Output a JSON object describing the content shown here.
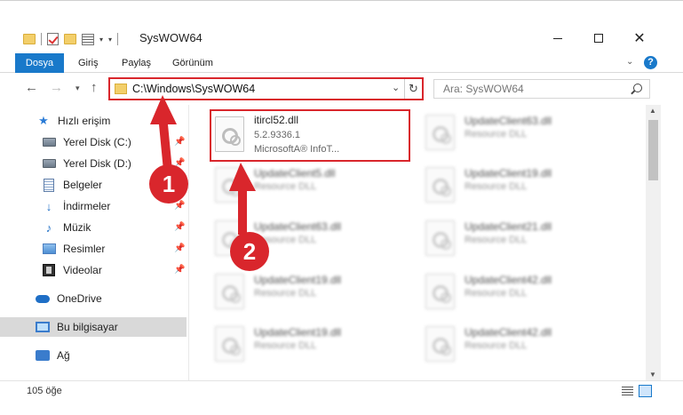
{
  "window": {
    "title": "SysWOW64",
    "qat_dropdown": "▾",
    "min": "",
    "max": "",
    "close": "✕"
  },
  "ribbon": {
    "tabs": [
      "Dosya",
      "Giriş",
      "Paylaş",
      "Görünüm"
    ],
    "help": "?",
    "collapse": "⌄"
  },
  "nav": {
    "back": "←",
    "forward": "→",
    "recent": "▾",
    "up": "↑",
    "address": "C:\\Windows\\SysWOW64",
    "address_drop": "⌄",
    "refresh": "↻",
    "search_placeholder": "Ara: SysWOW64"
  },
  "sidebar": {
    "items": [
      {
        "label": "Hızlı erişim",
        "icon": "star-icon",
        "pinned": false
      },
      {
        "label": "Yerel Disk (C:)",
        "icon": "disk-icon",
        "pinned": true
      },
      {
        "label": "Yerel Disk (D:)",
        "icon": "disk-icon",
        "pinned": true
      },
      {
        "label": "Belgeler",
        "icon": "document-icon",
        "pinned": true
      },
      {
        "label": "İndirmeler",
        "icon": "download-icon",
        "pinned": true
      },
      {
        "label": "Müzik",
        "icon": "music-icon",
        "pinned": true
      },
      {
        "label": "Resimler",
        "icon": "pictures-icon",
        "pinned": true
      },
      {
        "label": "Videolar",
        "icon": "video-icon",
        "pinned": true
      },
      {
        "label": "OneDrive",
        "icon": "cloud-icon",
        "pinned": false
      },
      {
        "label": "Bu bilgisayar",
        "icon": "computer-icon",
        "pinned": false
      },
      {
        "label": "Ağ",
        "icon": "network-icon",
        "pinned": false
      }
    ],
    "pin_glyph": "📌"
  },
  "files": {
    "highlighted": {
      "name": "itircl52.dll",
      "version": "5.2.9336.1",
      "company": "MicrosoftA® InfoT..."
    },
    "left_column": [
      {
        "name": "UpdateClient5.dll",
        "type": "Resource DLL"
      },
      {
        "name": "UpdateClient63.dll",
        "type": "Resource DLL"
      },
      {
        "name": "UpdateClient19.dll",
        "type": "Resource DLL"
      },
      {
        "name": "UpdateClient19.dll",
        "type": "Resource DLL"
      }
    ],
    "right_column": [
      {
        "name": "UpdateClient63.dll",
        "type": "Resource DLL"
      },
      {
        "name": "UpdateClient19.dll",
        "type": "Resource DLL"
      },
      {
        "name": "UpdateClient21.dll",
        "type": "Resource DLL"
      },
      {
        "name": "UpdateClient42.dll",
        "type": "Resource DLL"
      },
      {
        "name": "UpdateClient42.dll",
        "type": "Resource DLL"
      }
    ]
  },
  "status": {
    "item_count": "105 öğe"
  },
  "annotations": {
    "step1": "1",
    "step2": "2",
    "color": "#d9262c"
  },
  "colors": {
    "accent": "#1979ca",
    "highlight": "#d9262c"
  }
}
